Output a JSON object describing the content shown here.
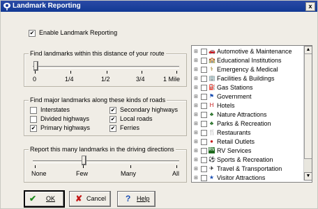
{
  "title": "Landmark Reporting",
  "close_label": "x",
  "enable": {
    "label": "Enable Landmark Reporting",
    "checked": true
  },
  "distance": {
    "group_label": "Find landmarks within this distance of your route",
    "ticks": [
      "0",
      "1/4",
      "1/2",
      "3/4",
      "1 Mile"
    ],
    "value_fraction": 0.0
  },
  "roads": {
    "group_label": "Find major landmarks along these kinds of roads",
    "items": [
      {
        "label": "Interstates",
        "checked": false
      },
      {
        "label": "Divided highways",
        "checked": false
      },
      {
        "label": "Primary highways",
        "checked": true
      },
      {
        "label": "Secondary highways",
        "checked": true
      },
      {
        "label": "Local roads",
        "checked": true
      },
      {
        "label": "Ferries",
        "checked": true
      }
    ]
  },
  "report": {
    "group_label": "Report this many landmarks in the driving directions",
    "ticks": [
      "None",
      "Few",
      "Many",
      "All"
    ],
    "value": "Few"
  },
  "categories": [
    {
      "label": "Automotive & Maintenance",
      "icon": "car-icon",
      "glyph": "🚗",
      "color": "#1b4fb3"
    },
    {
      "label": "Educational Institutions",
      "icon": "school-icon",
      "glyph": "🏫",
      "color": "#b02a1f"
    },
    {
      "label": "Emergency & Medical",
      "icon": "medical-icon",
      "glyph": "⚕",
      "color": "#8a6a00"
    },
    {
      "label": "Facilities & Buildings",
      "icon": "building-icon",
      "glyph": "🏢",
      "color": "#6d6d6d"
    },
    {
      "label": "Gas Stations",
      "icon": "gas-icon",
      "glyph": "⛽",
      "color": "#1b4fb3"
    },
    {
      "label": "Government",
      "icon": "flag-icon",
      "glyph": "⚑",
      "color": "#1b4fb3"
    },
    {
      "label": "Hotels",
      "icon": "hotel-icon",
      "glyph": "H",
      "color": "#c41818"
    },
    {
      "label": "Nature Attractions",
      "icon": "tree-icon",
      "glyph": "♣",
      "color": "#1e6a1e"
    },
    {
      "label": "Parks & Recreation",
      "icon": "park-icon",
      "glyph": "♣",
      "color": "#1e6a1e"
    },
    {
      "label": "Restaurants",
      "icon": "restaurant-icon",
      "glyph": "🍴",
      "color": "#1b4fb3"
    },
    {
      "label": "Retail Outlets",
      "icon": "retail-icon",
      "glyph": "●",
      "color": "#c41818"
    },
    {
      "label": "RV Services",
      "icon": "rv-icon",
      "glyph": "RV",
      "color": "#1e6a1e"
    },
    {
      "label": "Sports & Recreation",
      "icon": "sports-icon",
      "glyph": "⚽",
      "color": "#8a6a00"
    },
    {
      "label": "Travel & Transportation",
      "icon": "airplane-icon",
      "glyph": "✈",
      "color": "#000000"
    },
    {
      "label": "Visitor Attractions",
      "icon": "visitor-icon",
      "glyph": "★",
      "color": "#1b4fb3"
    }
  ],
  "buttons": {
    "ok": "OK",
    "cancel": "Cancel",
    "help": "Help"
  },
  "colors": {
    "title_bar": "#1e3f9e",
    "dialog_bg": "#f0ede6",
    "check": "#000000"
  }
}
